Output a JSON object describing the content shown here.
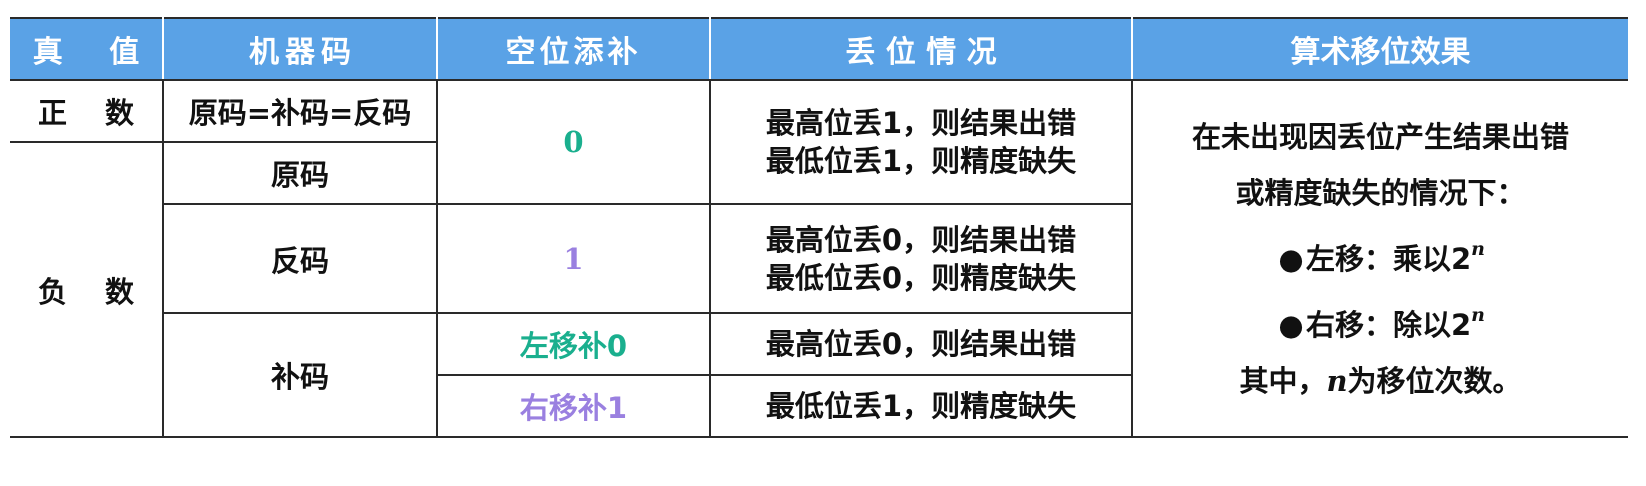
{
  "header": {
    "true_value": "真 值",
    "machine_code": "机器码",
    "fill": "空位添补",
    "loss": "丢 位 情 况",
    "effect": "算术移位效果"
  },
  "rows": {
    "positive": "正 数",
    "negative": "负 数",
    "positive_code": "原码=补码=反码",
    "sign_magnitude": "原码",
    "ones_complement": "反码",
    "twos_complement": "补码"
  },
  "fill": {
    "zero": "0",
    "one": "1",
    "left_fill_0": "左移补0",
    "right_fill_1": "右移补1"
  },
  "loss": {
    "high_lose_1": "最高位丢1，则结果出错",
    "low_lose_1": "最低位丢1，则精度缺失",
    "high_lose_0": "最高位丢0，则结果出错",
    "low_lose_0": "最低位丢0，则精度缺失"
  },
  "effect": {
    "line1": "在未出现因丢位产生结果出错",
    "line2": "或精度缺失的情况下：",
    "bullet": "●",
    "left_shift": "左移：乘以2",
    "right_shift": "右移：除以2",
    "exponent": "n",
    "note_prefix": "其中，",
    "note_var": "n",
    "note_suffix": "为移位次数。"
  }
}
